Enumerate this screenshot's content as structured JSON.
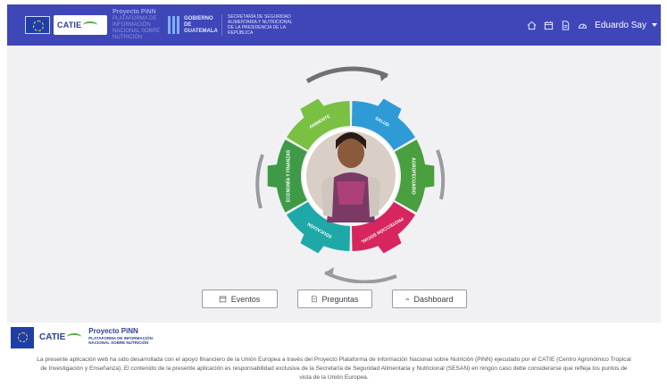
{
  "header": {
    "eu_flag": "eu-flag-logo",
    "catie_logo": "CATIE",
    "project_title": "Proyecto PiNN",
    "project_subtitle": "PLATAFORMA DE INFORMACIÓN NACIONAL SOBRE NUTRICIÓN",
    "guatemala_logo": "GOBIERNO DE GUATEMALA",
    "sesan_text": "SECRETARÍA DE SEGURIDAD ALIMENTARIA Y NUTRICIONAL DE LA PRESIDENCIA DE LA REPÚBLICA",
    "nav_icons": [
      "home-icon",
      "calendar-icon",
      "document-icon",
      "dashboard-icon"
    ],
    "user_name": "Eduardo Say"
  },
  "main": {
    "gear_segments": [
      {
        "label": "AMBIENTE",
        "color": "#7ac043"
      },
      {
        "label": "SALUD",
        "color": "#2e9bd6"
      },
      {
        "label": "AGROPECUARIO",
        "color": "#4a9f3e"
      },
      {
        "label": "PROTECCIÓN SOCIAL",
        "color": "#d7265e"
      },
      {
        "label": "EDUCACIÓN",
        "color": "#1ea9a8"
      },
      {
        "label": "ECONOMÍA Y FINANZAS",
        "color": "#3f9a48"
      }
    ],
    "buttons": {
      "eventos": "Eventos",
      "preguntas": "Preguntas",
      "dashboard": "Dashboard"
    }
  },
  "footer": {
    "catie_logo": "CATIE",
    "project_title": "Proyecto PiNN",
    "project_subtitle_1": "PLATAFORMA DE INFORMACIÓN",
    "project_subtitle_2": "NACIONAL SOBRE NUTRICIÓN",
    "disclaimer": "La presente aplicación web ha sido desarrollada con el apoyo financiero de la Unión Europea a través del Proyecto Plataforma de información Nacional sobre Nutrición (PiNN) ejecutado por el CATIE (Centro Agronómico Tropical de Investigación y Enseñanza). El contenido de la presente aplicación es responsabilidad exclusiva de la Secretaría de Seguridad Alimentaria y Nutricional (SESAN) en ningún caso debe considerarse que refleja los puntos de vista de la Unión Europea."
  }
}
